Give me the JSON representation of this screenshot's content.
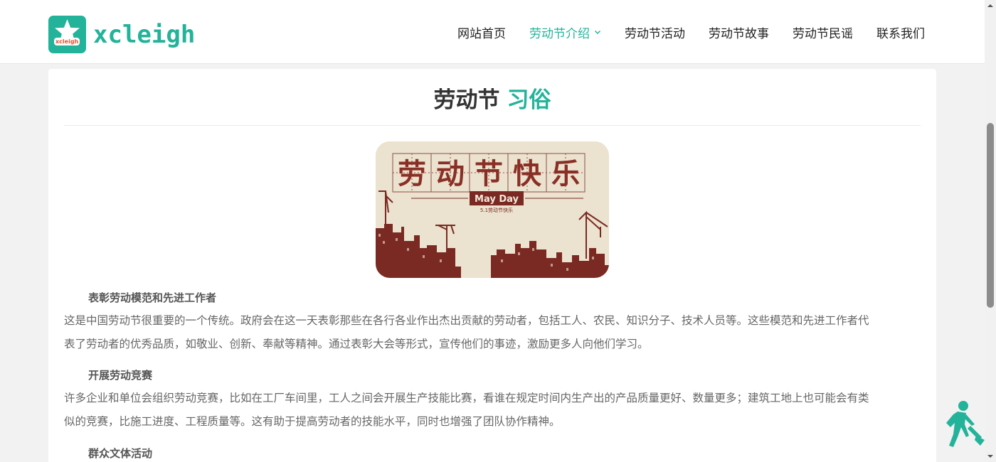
{
  "brand": {
    "name": "xcleigh",
    "badge_text": "xcleigh",
    "color": "#23b39a"
  },
  "nav": {
    "items": [
      {
        "label": "网站首页"
      },
      {
        "label": "劳动节介绍",
        "active": true
      },
      {
        "label": "劳动节活动"
      },
      {
        "label": "劳动节故事"
      },
      {
        "label": "劳动节民谣"
      },
      {
        "label": "联系我们"
      }
    ]
  },
  "page": {
    "title_main": "劳动节",
    "title_accent": "习俗"
  },
  "hero": {
    "headline_chars": [
      "劳",
      "动",
      "节",
      "快",
      "乐"
    ],
    "ribbon_text": "May Day",
    "sub_text": "5.1劳动节快乐",
    "colors": {
      "paper": "#efe6d6",
      "ink": "#7a2a22"
    }
  },
  "sections": [
    {
      "title": "表彰劳动模范和先进工作者",
      "lines": [
        "这是中国劳动节很重要的一个传统。政府会在这一天表彰那些在各行各业作出杰出贡献的劳动者，包括工人、农民、知识分子、技术人员等。这些模范和先进工作者代",
        "表了劳动者的优秀品质，如敬业、创新、奉献等精神。通过表彰大会等形式，宣传他们的事迹，激励更多人向他们学习。"
      ]
    },
    {
      "title": "开展劳动竞赛",
      "lines": [
        "许多企业和单位会组织劳动竞赛，比如在工厂车间里，工人之间会开展生产技能比赛，看谁在规定时间内生产出的产品质量更好、数量更多；建筑工地上也可能会有类",
        "似的竞赛，比施工进度、工程质量等。这有助于提高劳动者的技能水平，同时也增强了团队协作精神。"
      ]
    },
    {
      "title": "群众文体活动",
      "lines": []
    }
  ],
  "icons": {
    "float": "worker-shovel-icon",
    "nav_dropdown": "chevron-down-icon"
  }
}
